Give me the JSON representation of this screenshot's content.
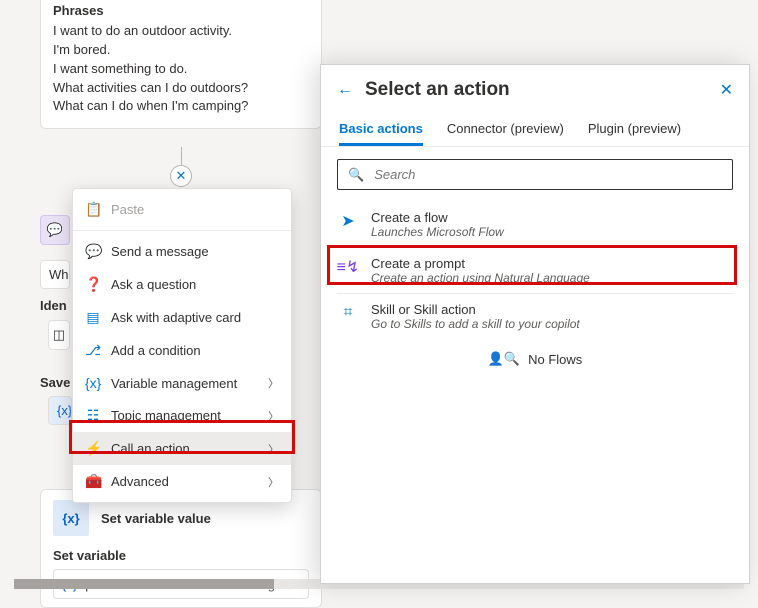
{
  "phrases": {
    "title": "Phrases",
    "items": [
      "I want to do an outdoor activity.",
      "I'm bored.",
      "I want something to do.",
      "What activities can I do outdoors?",
      "What can I do when I'm camping?"
    ]
  },
  "left_labels": {
    "wh": "Wh",
    "iden": "Iden",
    "save": "Save",
    "vx_input": "{x}"
  },
  "context_menu": {
    "paste": "Paste",
    "send_message": "Send a message",
    "ask_question": "Ask a question",
    "ask_adaptive": "Ask with adaptive card",
    "add_condition": "Add a condition",
    "variable_mgmt": "Variable management",
    "topic_mgmt": "Topic management",
    "call_action": "Call an action",
    "advanced": "Advanced"
  },
  "set_variable": {
    "title": "Set variable value",
    "label": "Set variable",
    "var_token": "{x}",
    "var_name": "productName",
    "var_type": "string"
  },
  "panel": {
    "title": "Select an action",
    "tabs": {
      "basic": "Basic actions",
      "connector": "Connector (preview)",
      "plugin": "Plugin (preview)"
    },
    "search_placeholder": "Search",
    "actions": [
      {
        "title": "Create a flow",
        "desc": "Launches Microsoft Flow",
        "icon_color": "#0078d4",
        "icon": "➤"
      },
      {
        "title": "Create a prompt",
        "desc": "Create an action using Natural Language",
        "icon_color": "#7c3aed",
        "icon": "≡"
      },
      {
        "title": "Skill or Skill action",
        "desc": "Go to Skills to add a skill to your copilot",
        "icon_color": "#0078d4",
        "icon": "⌗"
      }
    ],
    "no_flows": "No Flows"
  }
}
